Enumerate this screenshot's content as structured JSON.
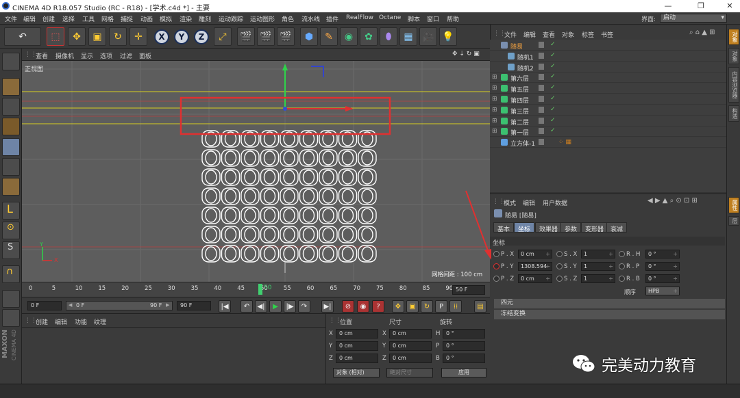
{
  "window": {
    "title": "CINEMA 4D R18.057 Studio (RC - R18) - [学术.c4d *] - 主要",
    "minimize": "—",
    "maximize": "❐",
    "close": "✕"
  },
  "menubar": {
    "items": [
      "文件",
      "编辑",
      "创建",
      "选择",
      "工具",
      "网格",
      "捕捉",
      "动画",
      "模拟",
      "渲染",
      "雕刻",
      "运动跟踪",
      "运动图形",
      "角色",
      "流水线",
      "插件",
      "RealFlow",
      "Octane",
      "脚本",
      "窗口",
      "帮助"
    ],
    "interface_label": "界面:",
    "interface_value": "启动"
  },
  "toolbar": {
    "axis_labels": [
      "X",
      "Y",
      "Z"
    ]
  },
  "viewport": {
    "menu": [
      "查看",
      "摄像机",
      "显示",
      "选项",
      "过滤",
      "面板"
    ],
    "view_name": "正视图",
    "grid_spacing": "网格间距 : 100 cm",
    "axis_y": "Y",
    "axis_x": "X"
  },
  "timeline": {
    "ticks": [
      "0",
      "5",
      "10",
      "15",
      "20",
      "25",
      "30",
      "35",
      "40",
      "45",
      "50",
      "55",
      "60",
      "65",
      "70",
      "75",
      "80",
      "85",
      "90"
    ],
    "current_frame": "50",
    "end_field": "50 F"
  },
  "playbar": {
    "start": "0 F",
    "range_start": "0 F",
    "range_end": "90 F",
    "end": "90 F"
  },
  "material_panel": {
    "menu": [
      "创建",
      "编辑",
      "功能",
      "纹理"
    ]
  },
  "coord_panel": {
    "headers": [
      "位置",
      "尺寸",
      "旋转"
    ],
    "rows": [
      {
        "axis": "X",
        "pos": "0 cm",
        "size_axis": "X",
        "size": "0 cm",
        "rot_axis": "H",
        "rot": "0 °"
      },
      {
        "axis": "Y",
        "pos": "0 cm",
        "size_axis": "Y",
        "size": "0 cm",
        "rot_axis": "P",
        "rot": "0 °"
      },
      {
        "axis": "Z",
        "pos": "0 cm",
        "size_axis": "Z",
        "size": "0 cm",
        "rot_axis": "B",
        "rot": "0 °"
      }
    ],
    "mode_select": "对象 (相对)",
    "size_select": "绝对尺寸",
    "apply": "应用"
  },
  "object_manager": {
    "menu": [
      "文件",
      "编辑",
      "查看",
      "对象",
      "标签",
      "书签"
    ],
    "objects": [
      {
        "name": "随易",
        "indent": 0,
        "color": "#7a8fb0",
        "selected": true
      },
      {
        "name": "随机1",
        "indent": 1,
        "color": "#6fa0c8",
        "selected": false
      },
      {
        "name": "随机2",
        "indent": 1,
        "color": "#6fa0c8",
        "selected": false
      },
      {
        "name": "第六层",
        "indent": 0,
        "color": "#3cc070",
        "selected": false
      },
      {
        "name": "第五层",
        "indent": 0,
        "color": "#3cc070",
        "selected": false
      },
      {
        "name": "第四层",
        "indent": 0,
        "color": "#3cc070",
        "selected": false
      },
      {
        "name": "第三层",
        "indent": 0,
        "color": "#3cc070",
        "selected": false
      },
      {
        "name": "第二层",
        "indent": 0,
        "color": "#3cc070",
        "selected": false
      },
      {
        "name": "第一层",
        "indent": 0,
        "color": "#3cc070",
        "selected": false
      },
      {
        "name": "立方体-1",
        "indent": 0,
        "color": "#5f9fe0",
        "selected": false
      }
    ]
  },
  "attributes": {
    "menu": [
      "模式",
      "编辑",
      "用户数据"
    ],
    "object_title": "随易 [随易]",
    "tabs": [
      "基本",
      "坐标",
      "效果器",
      "参数",
      "变形器",
      "衰减"
    ],
    "active_tab": "坐标",
    "section": "坐标",
    "rows": [
      {
        "p_label": "P . X",
        "p_val": "0 cm",
        "s_label": "S . X",
        "s_val": "1",
        "r_label": "R . H",
        "r_val": "0 °"
      },
      {
        "p_label": "P . Y",
        "p_val": "1308.594",
        "s_label": "S . Y",
        "s_val": "1",
        "r_label": "R . P",
        "r_val": "0 °"
      },
      {
        "p_label": "P . Z",
        "p_val": "0 cm",
        "s_label": "S . Z",
        "s_val": "1",
        "r_label": "R . B",
        "r_val": "0 °"
      }
    ],
    "order_label": "顺序",
    "order_value": "HPB",
    "collapsed_sections": [
      "四元",
      "冻结变换"
    ]
  },
  "right_strip": {
    "tabs": [
      "对象",
      "内容浏览器",
      "构造",
      "属性",
      "层"
    ]
  },
  "branding": {
    "maxon": "MAXON",
    "product": "CINEMA 4D"
  },
  "watermark": {
    "text": "完美动力教育"
  },
  "colors": {
    "accent_blue": "#6e84a6",
    "highlight_red": "#e03030",
    "guide_yellow": "#d8d020",
    "axis_green": "#2fd34a",
    "check_green": "#66cc66"
  }
}
